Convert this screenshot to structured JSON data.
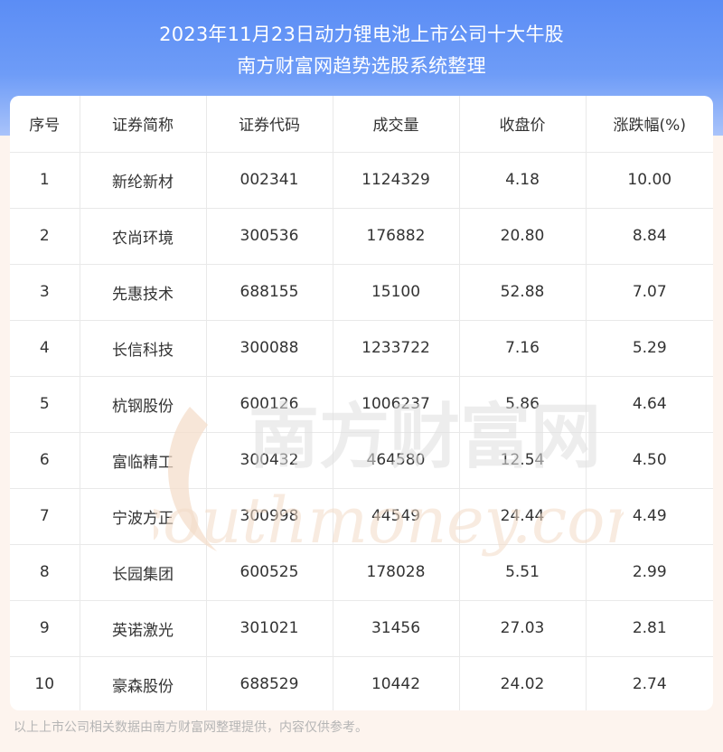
{
  "header": {
    "title_line1": "2023年11月23日动力锂电池上市公司十大牛股",
    "title_line2": "南方财富网趋势选股系统整理"
  },
  "table": {
    "columns": [
      "序号",
      "证券简称",
      "证券代码",
      "成交量",
      "收盘价",
      "涨跌幅(%)"
    ],
    "rows": [
      [
        "1",
        "新纶新材",
        "002341",
        "1124329",
        "4.18",
        "10.00"
      ],
      [
        "2",
        "农尚环境",
        "300536",
        "176882",
        "20.80",
        "8.84"
      ],
      [
        "3",
        "先惠技术",
        "688155",
        "15100",
        "52.88",
        "7.07"
      ],
      [
        "4",
        "长信科技",
        "300088",
        "1233722",
        "7.16",
        "5.29"
      ],
      [
        "5",
        "杭钢股份",
        "600126",
        "1006237",
        "5.86",
        "4.64"
      ],
      [
        "6",
        "富临精工",
        "300432",
        "464580",
        "12.54",
        "4.50"
      ],
      [
        "7",
        "宁波方正",
        "300998",
        "44549",
        "24.44",
        "4.49"
      ],
      [
        "8",
        "长园集团",
        "600525",
        "178028",
        "5.51",
        "2.99"
      ],
      [
        "9",
        "英诺激光",
        "301021",
        "31456",
        "27.03",
        "2.81"
      ],
      [
        "10",
        "豪森股份",
        "688529",
        "10442",
        "24.02",
        "2.74"
      ]
    ]
  },
  "watermark": {
    "cn": "南方财富网",
    "en": "southmoney.com"
  },
  "footer": {
    "note": "以上上市公司相关数据由南方财富网整理提供，内容仅供参考。"
  },
  "colors": {
    "header_top": "#5b8df5",
    "header_bottom": "#a9c3fa",
    "page_bg": "#fdf4ee"
  }
}
